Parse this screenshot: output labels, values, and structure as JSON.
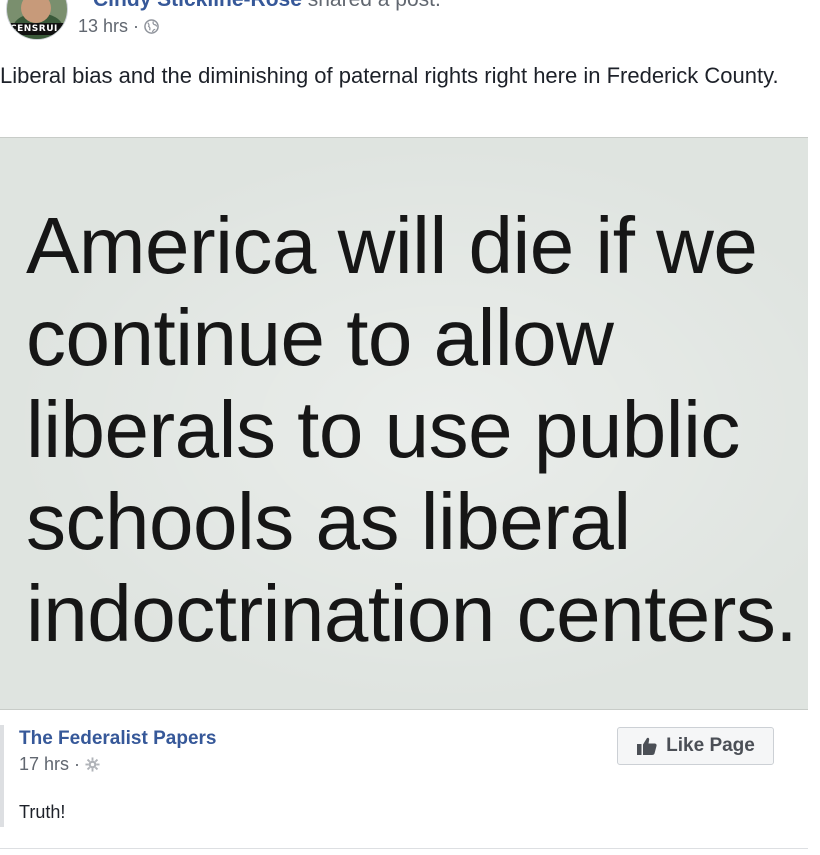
{
  "post": {
    "author_name": "Cindy Stickline-Rose",
    "action": " shared a post.",
    "timestamp": "13 hrs · ",
    "avatar_band_text": "CENSRUI",
    "text": "Liberal bias and the diminishing of paternal rights right here in Frederick County."
  },
  "image": {
    "text": "America will die if we\ncontinue to allow\nliberals to use public\nschools as liberal\nindoctrination centers."
  },
  "shared": {
    "page_name": "The Federalist Papers",
    "timestamp": "17 hrs · ",
    "text": "Truth!",
    "like_button_label": "Like Page"
  },
  "icons": {
    "privacy": "globe-icon",
    "shared_privacy": "gear-icon",
    "like": "thumbs-up-icon"
  },
  "colors": {
    "link": "#365899",
    "meta": "#616770",
    "image_bg": "#dfe4e0"
  }
}
